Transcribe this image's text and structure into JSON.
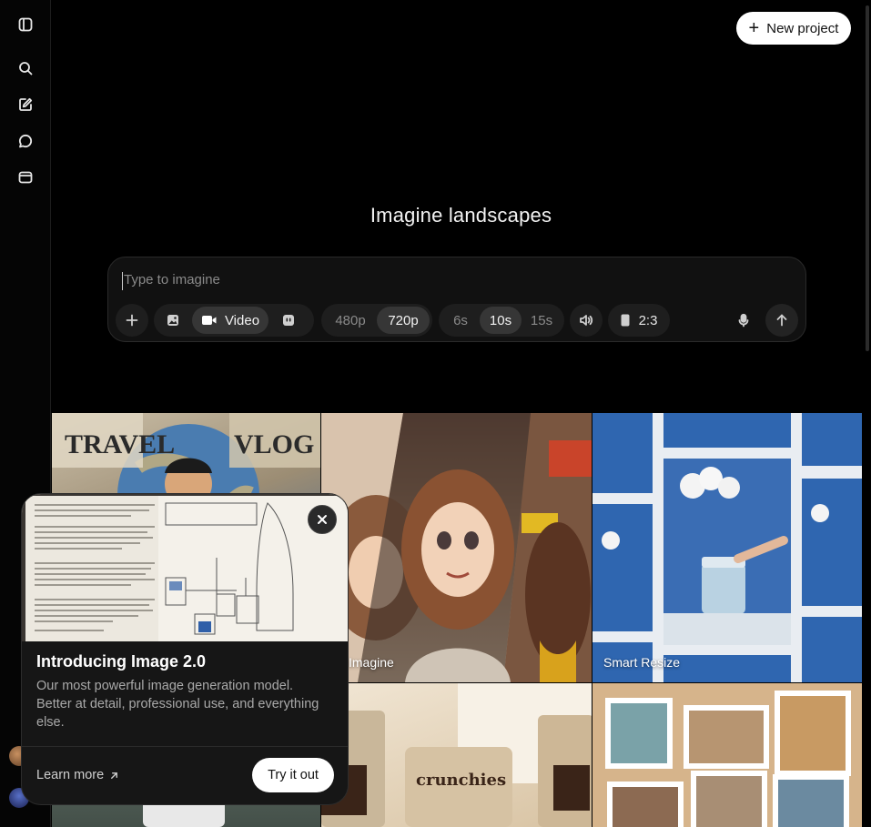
{
  "header": {
    "new_project_label": "New project"
  },
  "hero": {
    "title": "Imagine landscapes"
  },
  "composer": {
    "placeholder": "Type to imagine",
    "mode": {
      "video_label": "Video"
    },
    "resolution": {
      "options": [
        "480p",
        "720p"
      ],
      "selected": "720p"
    },
    "duration": {
      "options": [
        "6s",
        "10s",
        "15s"
      ],
      "selected": "10s"
    },
    "aspect_ratio": "2:3"
  },
  "gallery": {
    "tiles": [
      {
        "label": "",
        "image_text_1": "TRAVEL",
        "image_text_2": "VLOG"
      },
      {
        "label": "Imagine"
      },
      {
        "label": "Smart Resize"
      },
      {
        "label": ""
      },
      {
        "label": "",
        "image_text": "crunchies"
      },
      {
        "label": ""
      }
    ]
  },
  "promo": {
    "title": "Introducing Image 2.0",
    "description": "Our most powerful image generation model. Better at detail, professional use, and everything else.",
    "learn_more": "Learn more",
    "try_label": "Try it out"
  },
  "colors": {
    "background": "#000000",
    "surface": "#111111",
    "accent": "#ffffff"
  },
  "icons": [
    "sidebar-toggle-icon",
    "search-icon",
    "edit-icon",
    "chat-icon",
    "folder-icon",
    "plus-icon",
    "image-icon",
    "video-camera-icon",
    "character-icon",
    "speaker-icon",
    "portrait-ratio-icon",
    "microphone-icon",
    "arrow-up-icon",
    "close-icon",
    "arrow-up-right-icon"
  ]
}
